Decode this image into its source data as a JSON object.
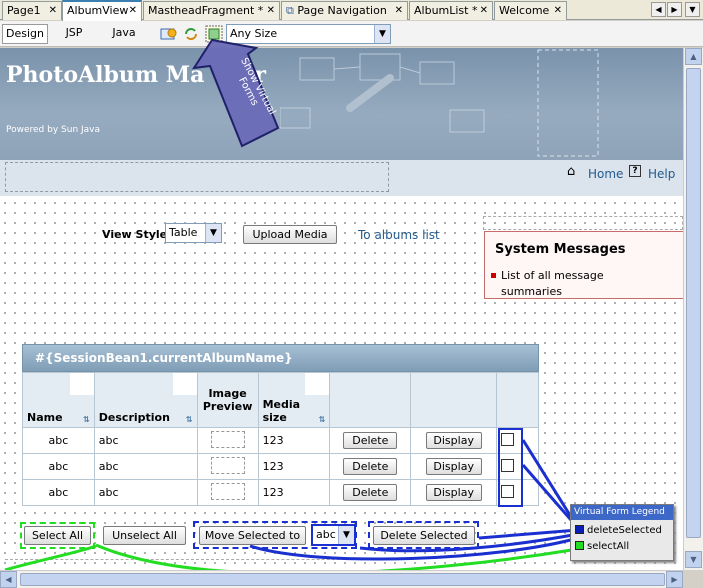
{
  "tabs": [
    {
      "label": "Page1"
    },
    {
      "label": "AlbumView"
    },
    {
      "label": "MastheadFragment *"
    },
    {
      "label": "Page Navigation"
    },
    {
      "label": "AlbumList *"
    },
    {
      "label": "Welcome"
    }
  ],
  "view_tabs": [
    "Design",
    "JSP",
    "Java"
  ],
  "toolbar": {
    "size_value": "Any Size",
    "virtual_forms_callout": "Show Virtual Forms"
  },
  "masthead": {
    "title": "PhotoAlbum Ma",
    "title_tail": "r",
    "subtitle": "Powered by Sun Java"
  },
  "nav": {
    "home": "Home",
    "help": "Help"
  },
  "controls": {
    "view_style_label": "View Style",
    "view_style_value": "Table",
    "upload_button": "Upload Media",
    "albums_link": "To albums list"
  },
  "system_messages": {
    "title": "System Messages",
    "item": "List of all message summaries"
  },
  "table": {
    "title": "#{SessionBean1.currentAlbumName}",
    "columns": [
      "Name",
      "Description",
      "Image Preview",
      "Media size"
    ],
    "rows": [
      {
        "name": "abc",
        "description": "abc",
        "size": "123",
        "delete": "Delete",
        "display": "Display"
      },
      {
        "name": "abc",
        "description": "abc",
        "size": "123",
        "delete": "Delete",
        "display": "Display"
      },
      {
        "name": "abc",
        "description": "abc",
        "size": "123",
        "delete": "Delete",
        "display": "Display"
      }
    ]
  },
  "actions": {
    "select_all": "Select All",
    "unselect_all": "Unselect All",
    "move_selected": "Move Selected to",
    "move_target": "abc",
    "delete_selected": "Delete Selected"
  },
  "legend": {
    "title": "Virtual Form Legend",
    "items": [
      {
        "label": "deleteSelected",
        "color": "#0a1fb8"
      },
      {
        "label": "selectAll",
        "color": "#22dd22"
      }
    ]
  },
  "colors": {
    "delete_form": "#1a2fd0",
    "select_form": "#22dd22",
    "tab_accent": "#3c7fb1"
  }
}
